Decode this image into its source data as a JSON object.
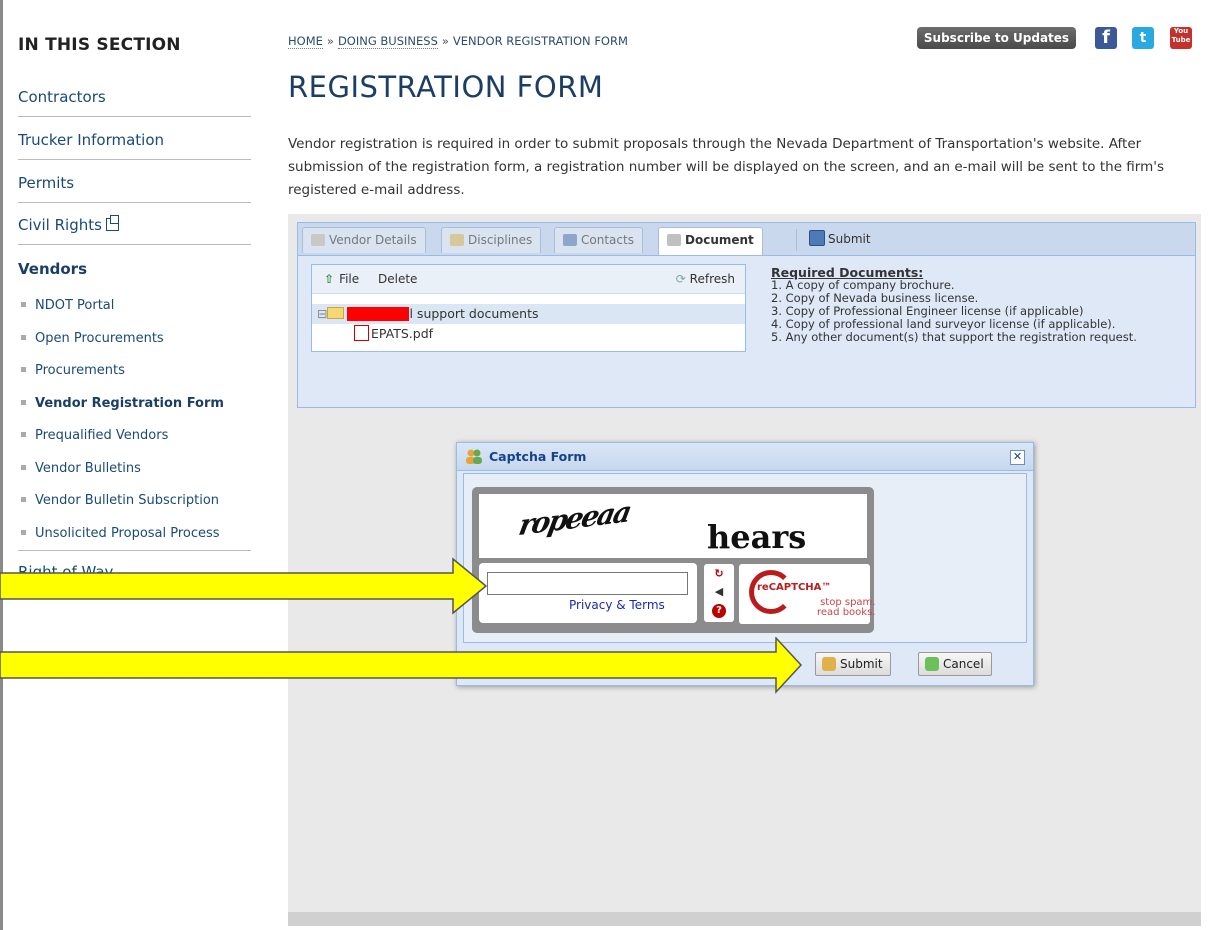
{
  "sidebar": {
    "title": "IN THIS SECTION",
    "items": [
      {
        "label": "Contractors"
      },
      {
        "label": "Trucker Information"
      },
      {
        "label": "Permits"
      },
      {
        "label": "Civil Rights"
      },
      {
        "label": "Vendors"
      }
    ],
    "sub_items": [
      {
        "label": "NDOT Portal"
      },
      {
        "label": "Open Procurements"
      },
      {
        "label": "Procurements"
      },
      {
        "label": "Vendor Registration Form"
      },
      {
        "label": "Prequalified Vendors"
      },
      {
        "label": "Vendor Bulletins"
      },
      {
        "label": "Vendor Bulletin Subscription"
      },
      {
        "label": "Unsolicited Proposal Process"
      }
    ],
    "partial_item": "Right of Way"
  },
  "breadcrumb": {
    "items": [
      "HOME",
      "DOING BUSINESS",
      "VENDOR REGISTRATION FORM"
    ],
    "separator": "»"
  },
  "header": {
    "subscribe_label": "Subscribe to Updates",
    "social": [
      "facebook-icon",
      "twitter-icon",
      "youtube-icon"
    ],
    "youtube_text": "You Tube"
  },
  "page": {
    "title": "REGISTRATION FORM",
    "intro": "Vendor registration is required in order to submit proposals through the Nevada Department of Transportation's website. After submission of the registration form, a registration number will be displayed on the screen, and an e-mail will be sent to the firm's registered e-mail address."
  },
  "form": {
    "tabs": [
      "Vendor Details",
      "Disciplines",
      "Contacts",
      "Document"
    ],
    "active_tab": "Document",
    "submit_label": "Submit",
    "toolbar": {
      "file": "File",
      "delete": "Delete",
      "refresh": "Refresh"
    },
    "tree": {
      "folder_suffix": "l support documents",
      "file": "EPATS.pdf"
    },
    "required": {
      "heading": "Required Documents:",
      "items": [
        "1. A copy of company brochure.",
        "2. Copy of Nevada business license.",
        "3. Copy of Professional Engineer license (if applicable)",
        "4. Copy of professional land surveyor license (if applicable).",
        "5. Any other document(s) that support the registration request."
      ]
    }
  },
  "captcha": {
    "title": "Captcha Form",
    "word1": "ropeeaa",
    "word2": "hears",
    "input_value": "",
    "privacy_label": "Privacy & Terms",
    "logo_text": "reCAPTCHA™",
    "tagline": "stop spam.\nread books.",
    "submit_label": "Submit",
    "cancel_label": "Cancel"
  },
  "colors": {
    "link": "#1b4a78",
    "title": "#1d3e64",
    "annotation_arrow": "#ffff00",
    "panel_border": "#99bbe8"
  }
}
